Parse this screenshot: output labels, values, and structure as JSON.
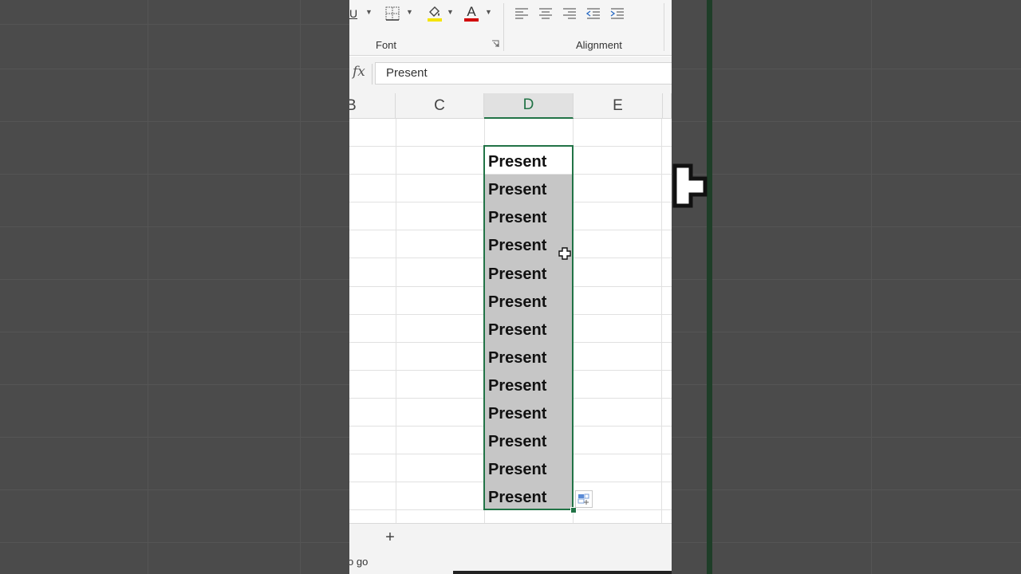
{
  "ribbon": {
    "font_group_label": "Font",
    "alignment_group_label": "Alignment",
    "underline_label": "U",
    "font_color_label": "A",
    "colors": {
      "fill_swatch": "#f5e400",
      "font_swatch": "#d10000",
      "accent": "#217346"
    }
  },
  "formula_bar": {
    "fx_label": "fx",
    "value": "Present"
  },
  "columns": [
    "B",
    "C",
    "D",
    "E"
  ],
  "selected_column": "D",
  "column_d_cells": [
    "Present",
    "Present",
    "Present",
    "Present",
    "Present",
    "Present",
    "Present",
    "Present",
    "Present",
    "Present",
    "Present",
    "Present",
    "Present"
  ],
  "sheet_bar": {
    "add_sheet_label": "+"
  },
  "status_bar": {
    "text": "o go"
  }
}
